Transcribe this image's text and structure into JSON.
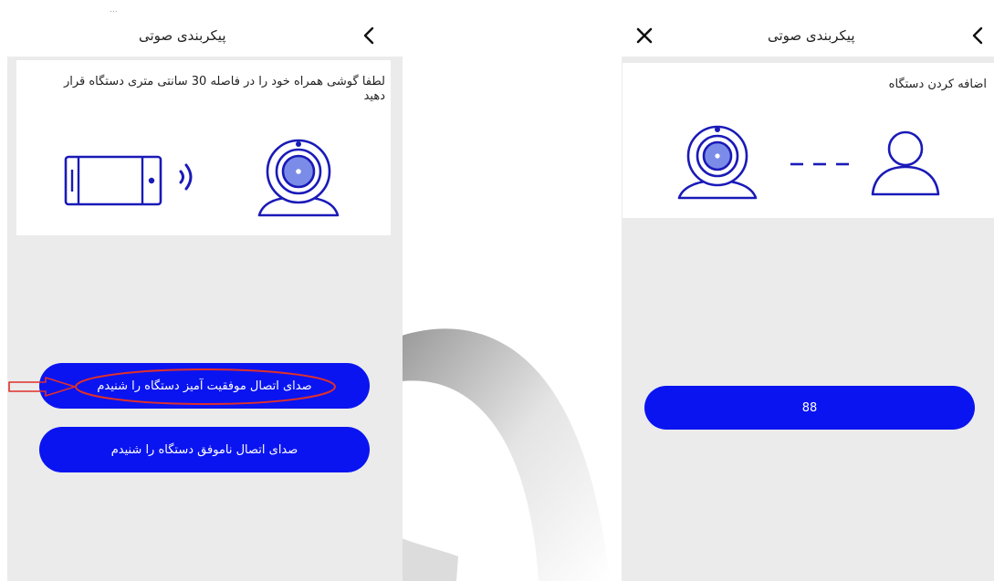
{
  "left": {
    "status_text": "...",
    "header": {
      "title": "پیکربندی صوتی"
    },
    "instruction": "لطفا گوشی همراه خود را در فاصله 30 سانتی متری دستگاه قرار دهید",
    "buttons": {
      "success": "صدای اتصال موفقیت آمیز دستگاه را شنیدم",
      "failure": "صدای اتصال ناموفق دستگاه را شنیدم"
    }
  },
  "right": {
    "header": {
      "title": "پیکربندی صوتی"
    },
    "card_title": "اضافه کردن دستگاه",
    "button": "88"
  },
  "icons": {
    "back": "chevron-left-icon",
    "close": "close-icon",
    "phone": "phone-icon",
    "sound": "sound-waves-icon",
    "camera": "webcam-icon",
    "user": "user-icon",
    "arrow": "annotation-arrow-icon"
  },
  "colors": {
    "accent": "#0a14f0",
    "icon_blue": "#1a1ab8",
    "lens": "#7b8ce8",
    "annotation": "#e0302a",
    "background": "#ebebeb"
  }
}
